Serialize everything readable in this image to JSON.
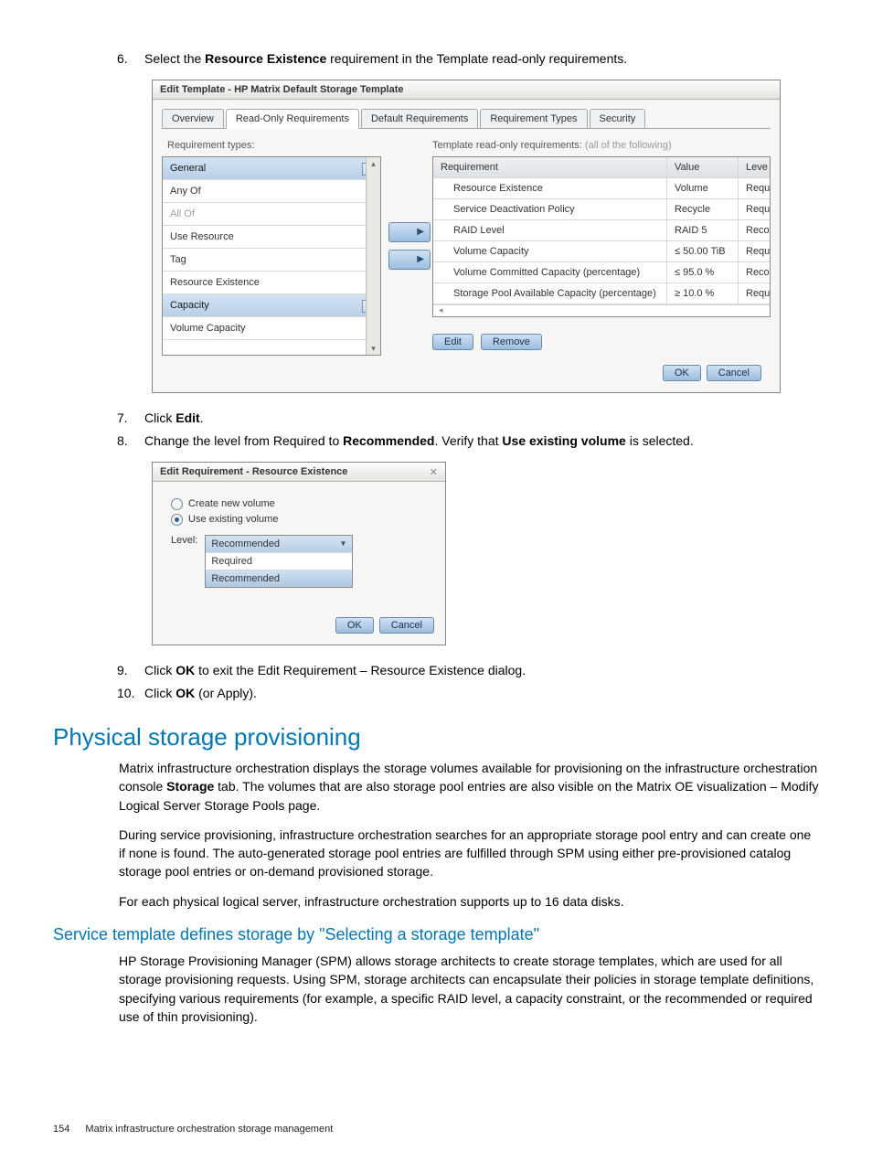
{
  "steps": {
    "s6_num": "6.",
    "s6_a": "Select the ",
    "s6_b": "Resource Existence",
    "s6_c": " requirement in the Template read-only requirements.",
    "s7_num": "7.",
    "s7_a": "Click ",
    "s7_b": "Edit",
    "s7_c": ".",
    "s8_num": "8.",
    "s8_a": "Change the level from Required to ",
    "s8_b": "Recommended",
    "s8_c": ". Verify that ",
    "s8_d": "Use existing volume",
    "s8_e": " is selected.",
    "s9_num": "9.",
    "s9_a": "Click ",
    "s9_b": "OK",
    "s9_c": " to exit the Edit Requirement – Resource Existence dialog.",
    "s10_num": "10.",
    "s10_a": "Click ",
    "s10_b": "OK",
    "s10_c": " (or Apply)."
  },
  "dlg1": {
    "title": "Edit Template - HP Matrix Default Storage Template",
    "tabs": [
      "Overview",
      "Read-Only Requirements",
      "Default Requirements",
      "Requirement Types",
      "Security"
    ],
    "active_tab_index": 1,
    "left_label": "Requirement types:",
    "left_items": [
      {
        "label": "General",
        "header": true
      },
      {
        "label": "Any Of"
      },
      {
        "label": "All Of",
        "disabled": true
      },
      {
        "label": "Use Resource"
      },
      {
        "label": "Tag"
      },
      {
        "label": "Resource Existence"
      },
      {
        "label": "Capacity",
        "header": true
      },
      {
        "label": "Volume Capacity"
      }
    ],
    "move1": "▶",
    "move2": "▶",
    "right_label_a": "Template read-only requirements:",
    "right_label_b": "  (all of the following)",
    "grid_head": [
      "Requirement",
      "Value",
      "Leve"
    ],
    "grid_rows": [
      {
        "req": "Resource Existence",
        "val": "Volume",
        "lvl": "Requ"
      },
      {
        "req": "Service Deactivation Policy",
        "val": "Recycle",
        "lvl": "Requ"
      },
      {
        "req": "RAID Level",
        "val": "RAID 5",
        "lvl": "Reco"
      },
      {
        "req": "Volume Capacity",
        "val": "≤ 50.00 TiB",
        "lvl": "Requ"
      },
      {
        "req": "Volume Committed Capacity (percentage)",
        "val": "≤ 95.0 %",
        "lvl": "Reco"
      },
      {
        "req": "Storage Pool Available Capacity (percentage)",
        "val": "≥ 10.0 %",
        "lvl": "Requ"
      }
    ],
    "edit_btn": "Edit",
    "remove_btn": "Remove",
    "ok_btn": "OK",
    "cancel_btn": "Cancel",
    "scroll_left_glyph": "◂"
  },
  "dlg2": {
    "title": "Edit Requirement - Resource Existence",
    "close_glyph": "✕",
    "radio1": "Create new volume",
    "radio2": "Use existing volume",
    "level_label": "Level:",
    "combo_value": "Recommended",
    "combo_arrow": "▼",
    "options": [
      "Required",
      "Recommended"
    ],
    "ok_btn": "OK",
    "cancel_btn": "Cancel"
  },
  "h2": "Physical storage provisioning",
  "p1_a": "Matrix infrastructure orchestration displays the storage volumes available for provisioning on the infrastructure orchestration console ",
  "p1_b": "Storage",
  "p1_c": " tab. The volumes that are also storage pool entries are also visible on the Matrix OE visualization – Modify Logical Server Storage Pools page.",
  "p2": "During service provisioning, infrastructure orchestration searches for an appropriate storage pool entry and can create one if none is found. The auto-generated storage pool entries are fulfilled through SPM using either pre-provisioned catalog storage pool entries or on-demand provisioned storage.",
  "p3": "For each physical logical server, infrastructure orchestration supports up to 16 data disks.",
  "h3": "Service template defines storage by \"Selecting a storage template\"",
  "p4": "HP Storage Provisioning Manager (SPM) allows storage architects to create storage templates, which are used for all storage provisioning requests. Using SPM, storage architects can encapsulate their policies in storage template definitions, specifying various requirements (for example, a specific RAID level, a capacity constraint, or the recommended or required use of thin provisioning).",
  "footer": {
    "page": "154",
    "text": "Matrix infrastructure orchestration storage management"
  }
}
